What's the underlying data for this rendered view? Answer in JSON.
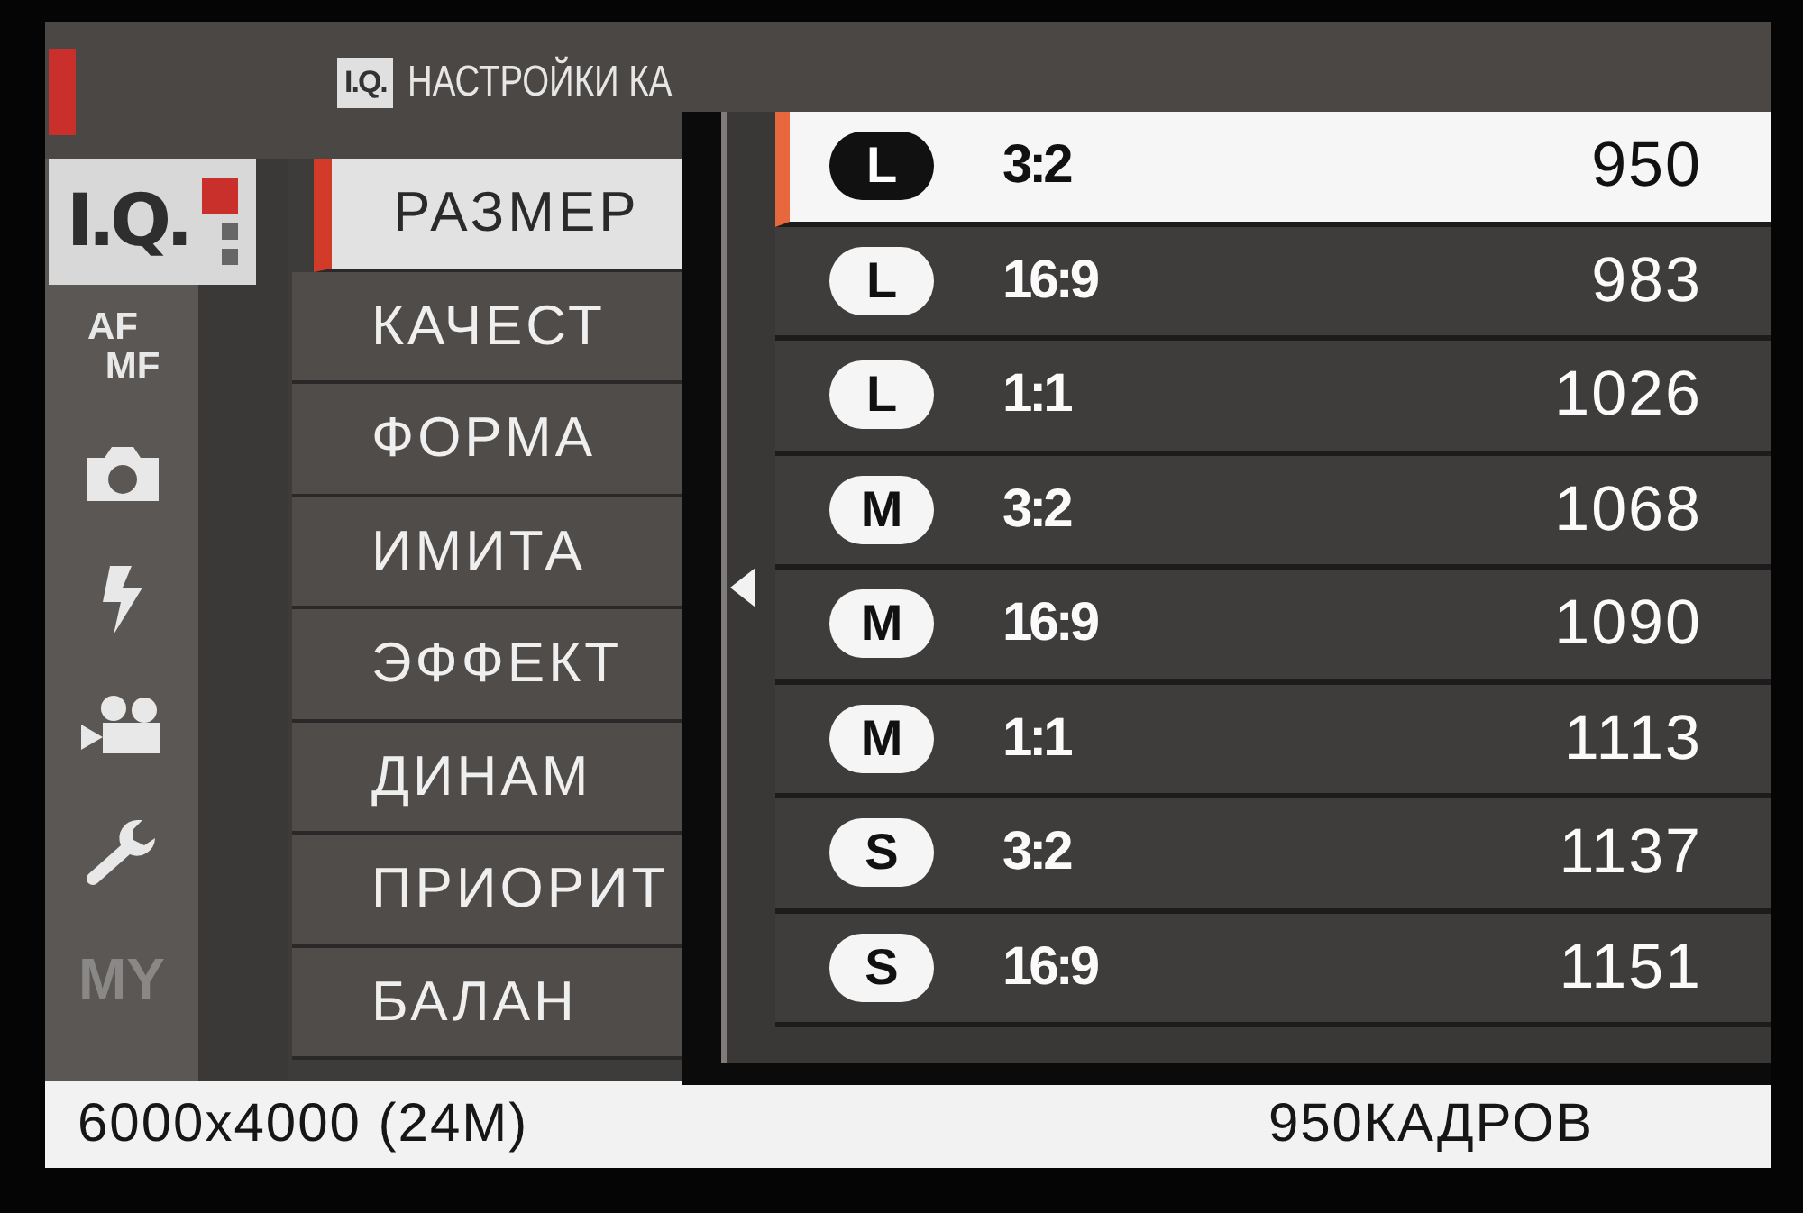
{
  "sidebar": {
    "tabs": [
      {
        "kind": "iq",
        "label": "I.Q.",
        "selected": true
      },
      {
        "kind": "text",
        "label": "AF",
        "label2": "MF",
        "selected": false
      },
      {
        "kind": "camera",
        "selected": false
      },
      {
        "kind": "flash",
        "selected": false
      },
      {
        "kind": "movie",
        "selected": false
      },
      {
        "kind": "wrench",
        "selected": false
      },
      {
        "kind": "my",
        "label": "MY",
        "selected": false
      }
    ]
  },
  "header": {
    "badge": "I.Q.",
    "title": "НАСТРОЙКИ КА"
  },
  "menu": [
    {
      "label": "РАЗМЕР",
      "selected": true
    },
    {
      "label": "КАЧЕСТ",
      "selected": false
    },
    {
      "label": "ФОРМА",
      "selected": false
    },
    {
      "label": "ИМИТА",
      "selected": false
    },
    {
      "label": "ЭФФЕКТ",
      "selected": false
    },
    {
      "label": "ДИНАМ",
      "selected": false
    },
    {
      "label": "ПРИОРИТ",
      "selected": false
    },
    {
      "label": "БАЛАН",
      "selected": false
    }
  ],
  "popup": {
    "options": [
      {
        "size": "L",
        "ratio": "3:2",
        "count": "950",
        "selected": true
      },
      {
        "size": "L",
        "ratio": "16:9",
        "count": "983",
        "selected": false
      },
      {
        "size": "L",
        "ratio": "1:1",
        "count": "1026",
        "selected": false
      },
      {
        "size": "M",
        "ratio": "3:2",
        "count": "1068",
        "selected": false
      },
      {
        "size": "M",
        "ratio": "16:9",
        "count": "1090",
        "selected": false
      },
      {
        "size": "M",
        "ratio": "1:1",
        "count": "1113",
        "selected": false
      },
      {
        "size": "S",
        "ratio": "3:2",
        "count": "1137",
        "selected": false
      },
      {
        "size": "S",
        "ratio": "16:9",
        "count": "1151",
        "selected": false
      }
    ]
  },
  "status_bar": {
    "resolution": "6000x4000 (24M)",
    "frames": "950КАДРОВ"
  }
}
